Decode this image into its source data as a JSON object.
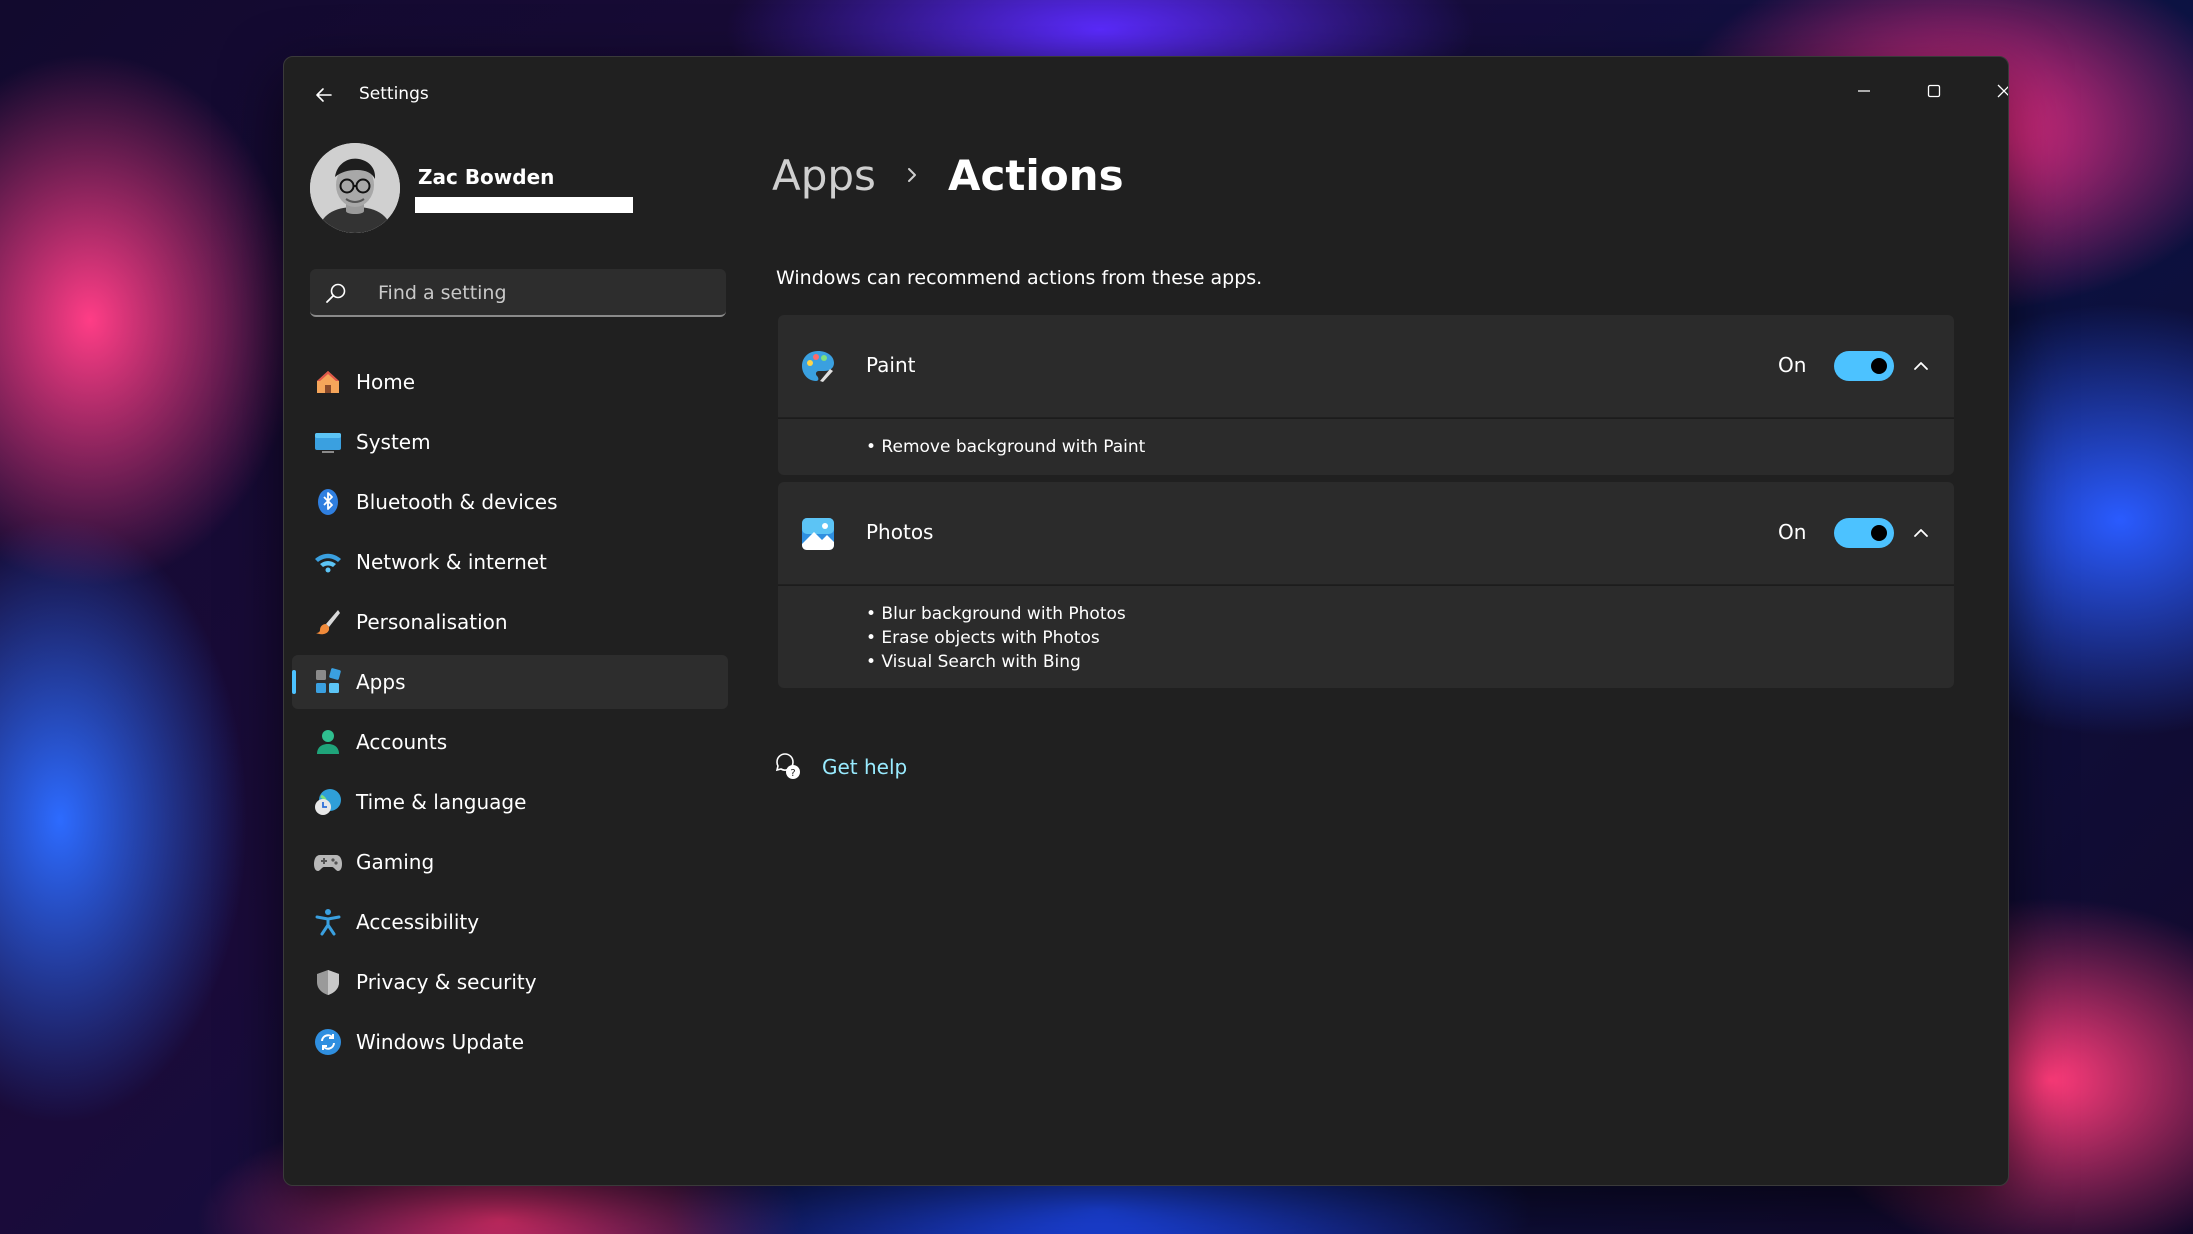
{
  "window": {
    "title": "Settings"
  },
  "profile": {
    "name": "Zac Bowden"
  },
  "search": {
    "placeholder": "Find a setting"
  },
  "nav": {
    "items": [
      {
        "label": "Home",
        "icon": "home-icon"
      },
      {
        "label": "System",
        "icon": "system-icon"
      },
      {
        "label": "Bluetooth & devices",
        "icon": "bluetooth-icon"
      },
      {
        "label": "Network & internet",
        "icon": "wifi-icon"
      },
      {
        "label": "Personalisation",
        "icon": "brush-icon"
      },
      {
        "label": "Apps",
        "icon": "apps-icon",
        "selected": true
      },
      {
        "label": "Accounts",
        "icon": "person-icon"
      },
      {
        "label": "Time & language",
        "icon": "globe-clock-icon"
      },
      {
        "label": "Gaming",
        "icon": "gamepad-icon"
      },
      {
        "label": "Accessibility",
        "icon": "accessibility-icon"
      },
      {
        "label": "Privacy & security",
        "icon": "shield-icon"
      },
      {
        "label": "Windows Update",
        "icon": "update-icon"
      }
    ]
  },
  "breadcrumb": {
    "parent": "Apps",
    "current": "Actions"
  },
  "main": {
    "description": "Windows can recommend actions from these apps.",
    "apps": [
      {
        "name": "Paint",
        "state": "On",
        "enabled": true,
        "icon": "paint-icon",
        "actions": [
          "• Remove background with Paint"
        ]
      },
      {
        "name": "Photos",
        "state": "On",
        "enabled": true,
        "icon": "photos-icon",
        "actions": [
          "• Blur background with Photos",
          "• Erase objects with Photos",
          "• Visual Search with Bing"
        ]
      }
    ]
  },
  "help": {
    "label": "Get help"
  },
  "colors": {
    "accent": "#4cc2ff",
    "window_bg": "#202020",
    "card_bg": "#2b2b2b",
    "link": "#99ebff"
  }
}
